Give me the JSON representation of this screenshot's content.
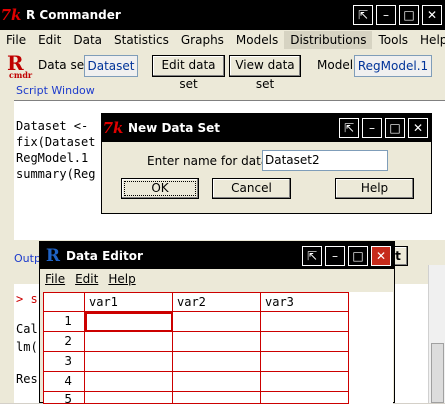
{
  "main_window": {
    "title": "R Commander",
    "menu": [
      "File",
      "Edit",
      "Data",
      "Statistics",
      "Graphs",
      "Models",
      "Distributions",
      "Tools",
      "Help"
    ],
    "logo_text": "Rcmdr",
    "dataset_label": "Data set:",
    "dataset_value": "Dataset",
    "edit_button": "Edit data set",
    "view_button": "View data set",
    "model_label": "Model:",
    "model_value": "RegModel.1",
    "script_window_label": "Script Window",
    "script_lines": [
      "Dataset <-",
      "fix(Dataset",
      "RegModel.1",
      "summary(Reg"
    ],
    "output_label": "Outp",
    "output_lines": [
      "> s",
      "Cal",
      "lm(",
      "Res"
    ],
    "partial_button_text": "t"
  },
  "new_dataset_dialog": {
    "title": "New Data Set",
    "prompt": "Enter name for data set:",
    "input_value": "Dataset2",
    "ok": "OK",
    "cancel": "Cancel",
    "help": "Help"
  },
  "data_editor": {
    "title": "Data Editor",
    "menu": [
      "File",
      "Edit",
      "Help"
    ],
    "columns": [
      "var1",
      "var2",
      "var3"
    ],
    "rows": [
      "1",
      "2",
      "3",
      "4",
      "5"
    ]
  }
}
